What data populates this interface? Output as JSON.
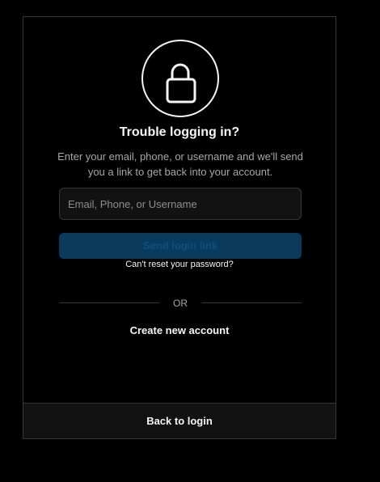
{
  "icon": {
    "name": "lock-icon"
  },
  "title": "Trouble logging in?",
  "description": "Enter your email, phone, or username and we'll send you a link to get back into your account.",
  "form": {
    "input_placeholder": "Email, Phone, or Username",
    "input_value": "",
    "submit_label": "Send login link",
    "submit_state": "disabled"
  },
  "reset_link": "Can't reset your password?",
  "divider_text": "OR",
  "create_account_label": "Create new account",
  "footer": {
    "back_label": "Back to login"
  },
  "colors": {
    "background": "#000000",
    "text": "#f5f5f5",
    "muted_text": "#a8a8a8",
    "border": "#363636",
    "button_disabled_bg": "#0a3a5c"
  }
}
